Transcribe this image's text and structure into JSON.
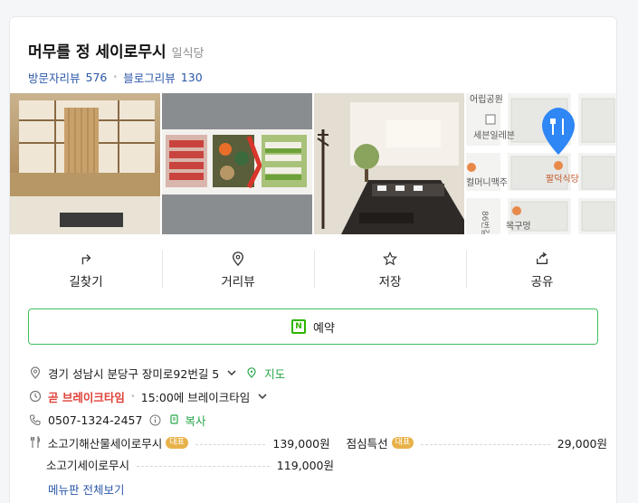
{
  "place": {
    "name": "머무를 정 세이로무시",
    "category": "일식당",
    "visitor_review_label": "방문자리뷰",
    "visitor_review_count": "576",
    "blog_review_label": "블로그리뷰",
    "blog_review_count": "130"
  },
  "map": {
    "labels": [
      "어립공원",
      "세븐일레븐",
      "팔덕식당",
      "컬머니맥주",
      "목구멍",
      "86번길"
    ]
  },
  "actions": [
    {
      "label": "길찾기",
      "icon": "directions-icon"
    },
    {
      "label": "거리뷰",
      "icon": "location-pin-icon"
    },
    {
      "label": "저장",
      "icon": "star-icon"
    },
    {
      "label": "공유",
      "icon": "share-icon"
    }
  ],
  "reserve": {
    "label": "예약",
    "badge": "N"
  },
  "info": {
    "address": "경기 성남시 분당구 장미로92번길 5",
    "map_link": "지도",
    "status": "곧 브레이크타임",
    "break_time": "15:00에 브레이크타임",
    "phone": "0507-1324-2457",
    "copy": "복사"
  },
  "menu": [
    {
      "name": "소고기해산물세이로무시",
      "badge": "대표",
      "price": "139,000원"
    },
    {
      "name": "점심특선",
      "badge": "대표",
      "price": "29,000원"
    },
    {
      "name": "소고기세이로무시",
      "badge": "",
      "price": "119,000원"
    }
  ],
  "menu_more": "메뉴판 전체보기",
  "colors": {
    "accent_green": "#27a74a",
    "link_blue": "#2b57a8",
    "alert_red": "#e1413a",
    "pin_blue": "#2f86f5"
  }
}
